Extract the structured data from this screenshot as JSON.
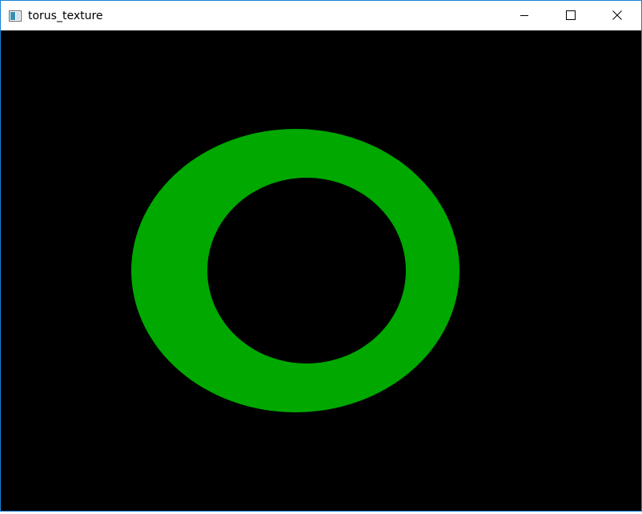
{
  "window": {
    "title": "torus_texture",
    "icon": "application-window-icon",
    "controls": {
      "minimize": "minimize-icon",
      "maximize": "maximize-icon",
      "close": "close-icon"
    }
  },
  "viewport": {
    "background_color": "#000000",
    "torus_color": "#00a800"
  }
}
